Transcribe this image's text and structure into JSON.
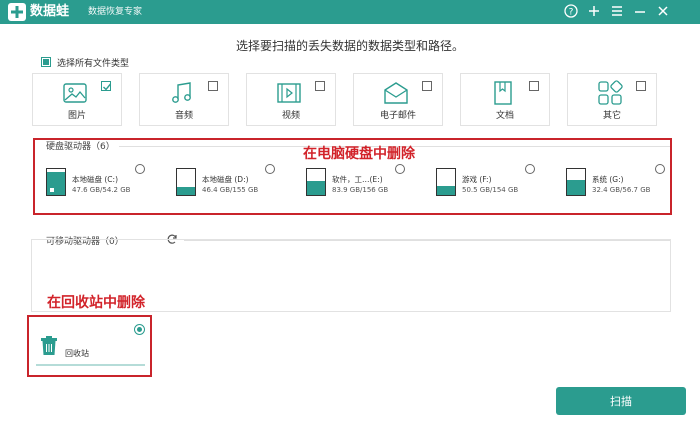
{
  "titlebar": {
    "app_name": "数据蛙",
    "subtitle": "数据恢复专家",
    "bg": "#2b9c8f",
    "icons": [
      "help-icon",
      "add-icon",
      "menu-icon",
      "minimize-icon",
      "close-icon"
    ]
  },
  "prompt": "选择要扫描的丢失数据的数据类型和路径。",
  "select_all": {
    "label": "选择所有文件类型",
    "checked": true
  },
  "file_types": [
    {
      "label": "图片",
      "icon": "image-icon",
      "checked": true
    },
    {
      "label": "音频",
      "icon": "music-icon",
      "checked": false
    },
    {
      "label": "视频",
      "icon": "video-icon",
      "checked": false
    },
    {
      "label": "电子邮件",
      "icon": "email-icon",
      "checked": false
    },
    {
      "label": "文档",
      "icon": "document-icon",
      "checked": false
    },
    {
      "label": "其它",
      "icon": "other-icon",
      "checked": false
    }
  ],
  "hard_drives": {
    "title": "硬盘驱动器（6）",
    "annotation": "在电脑硬盘中删除",
    "items": [
      {
        "name": "本地磁盘 (C:)",
        "size": "47.6 GB/54.2 GB",
        "used": 0.88
      },
      {
        "name": "本地磁盘 (D:)",
        "size": "46.4 GB/155 GB",
        "used": 0.3
      },
      {
        "name": "软件，工…(E:)",
        "size": "83.9 GB/156 GB",
        "used": 0.54
      },
      {
        "name": "游戏 (F:)",
        "size": "50.5 GB/154 GB",
        "used": 0.33
      },
      {
        "name": "系统 (G:)",
        "size": "32.4 GB/56.7 GB",
        "used": 0.57
      }
    ]
  },
  "removable": {
    "title": "可移动驱动器（0）",
    "icon": "refresh-icon"
  },
  "recycle": {
    "annotation": "在回收站中删除",
    "label": "回收站",
    "selected": true,
    "icon": "trash-icon"
  },
  "scan_button": "扫描",
  "colors": {
    "accent": "#2b9c8f",
    "annotation": "#d2232a"
  }
}
